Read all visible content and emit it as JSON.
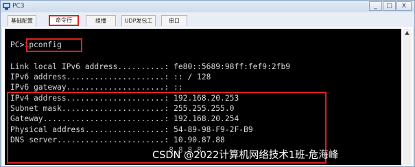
{
  "window": {
    "title": "PC3",
    "controls": {
      "minimize": "_",
      "maximize": "□",
      "close": "X"
    }
  },
  "tabs": [
    {
      "label": "基础配置",
      "active": false
    },
    {
      "label": "命令行",
      "active": true
    },
    {
      "label": "组播",
      "active": false
    },
    {
      "label": "UDP发包工具",
      "active": false
    },
    {
      "label": "串口",
      "active": false
    }
  ],
  "terminal": {
    "prompt": "PC>",
    "command": "ipconfig",
    "lines": [
      "Link local IPv6 address..........: fe80::5689:98ff:fef9:2fb9",
      "IPv6 address.....................: :: / 128",
      "IPv6 gateway.....................: ::",
      "IPv4 address.....................: 192.168.20.253",
      "Subnet mask......................: 255.255.255.0",
      "Gateway..........................: 192.168.20.254",
      "Physical address.................: 54-89-98-F9-2F-B9",
      "DNS server.......................: 10.90.87.88"
    ],
    "partial_line": "                                  8.8.8.8"
  },
  "scrollbar": {
    "up_arrow": "▲"
  },
  "watermark": "CSDN @2022计算机网络技术1班-危海峰",
  "colors": {
    "highlight": "#e02020",
    "terminal_bg": "#000000",
    "terminal_text": "#d9d9d9"
  }
}
